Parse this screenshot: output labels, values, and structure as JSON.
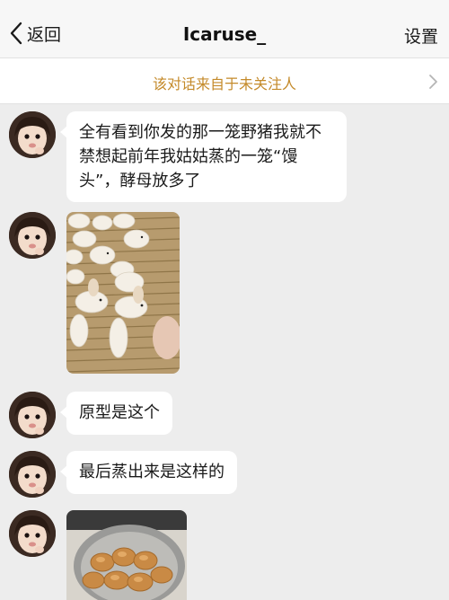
{
  "nav": {
    "back_label": "返回",
    "title": "Icaruse_",
    "settings_label": "设置"
  },
  "banner": {
    "text": "该对话来自于未关注人"
  },
  "messages": [
    {
      "type": "text",
      "text": "全有看到你发的那一笼野猪我就不禁想起前年我姑姑蒸的一笼“馒头”，酵母放多了"
    },
    {
      "type": "image"
    },
    {
      "type": "text",
      "text": "原型是这个"
    },
    {
      "type": "text",
      "text": "最后蒸出来是这样的"
    },
    {
      "type": "image"
    }
  ],
  "colors": {
    "banner_text": "#c48a2a",
    "chat_bg": "#ededed",
    "bubble_bg": "#ffffff"
  }
}
